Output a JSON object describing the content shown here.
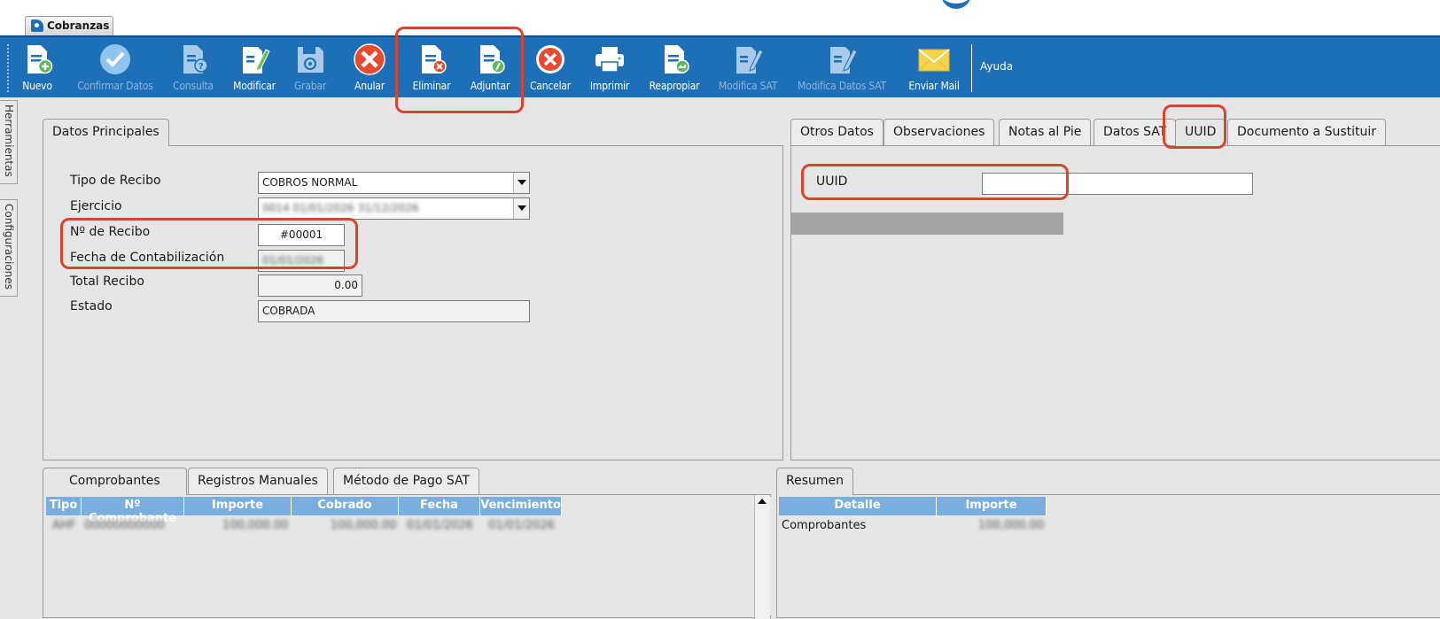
{
  "window": {
    "tab_label": "Cobranzas"
  },
  "toolbar": {
    "buttons": [
      {
        "label": "Nuevo",
        "icon": "new-document-icon",
        "enabled": true
      },
      {
        "label": "Confirmar Datos",
        "icon": "checkmark-icon",
        "enabled": false
      },
      {
        "label": "Consulta",
        "icon": "query-document-icon",
        "enabled": false
      },
      {
        "label": "Modificar",
        "icon": "edit-document-icon",
        "enabled": true
      },
      {
        "label": "Grabar",
        "icon": "save-disk-icon",
        "enabled": false
      },
      {
        "label": "Anular",
        "icon": "cancel-x-icon",
        "enabled": true
      },
      {
        "label": "Eliminar",
        "icon": "delete-document-icon",
        "enabled": true
      },
      {
        "label": "Adjuntar",
        "icon": "attach-document-icon",
        "enabled": true
      },
      {
        "label": "Cancelar",
        "icon": "cancel-circle-icon",
        "enabled": true
      },
      {
        "label": "Imprimir",
        "icon": "printer-icon",
        "enabled": true
      },
      {
        "label": "Reapropiar",
        "icon": "reassign-document-icon",
        "enabled": true
      },
      {
        "label": "Modifica SAT",
        "icon": "edit-sat-icon",
        "enabled": false
      },
      {
        "label": "Modifica Datos SAT",
        "icon": "edit-sat-data-icon",
        "enabled": false
      },
      {
        "label": "Enviar Mail",
        "icon": "mail-envelope-icon",
        "enabled": true
      }
    ],
    "help_label": "Ayuda"
  },
  "side_tabs": [
    "Herramientas",
    "Configuraciones"
  ],
  "main_panel": {
    "tab": "Datos Principales",
    "fields": {
      "tipo_recibo": {
        "label": "Tipo de Recibo",
        "value": "COBROS NORMAL"
      },
      "ejercicio": {
        "label": "Ejercicio",
        "value": "0014 01/01/2026 31/12/2026"
      },
      "nro_recibo": {
        "label": "Nº de Recibo",
        "value": "#00001"
      },
      "fecha_contab": {
        "label": "Fecha de Contabilización",
        "value": "01/01/2026"
      },
      "total_recibo": {
        "label": "Total Recibo",
        "value": "0.00"
      },
      "estado": {
        "label": "Estado",
        "value": "COBRADA"
      }
    }
  },
  "right_panel": {
    "tabs": [
      "Otros Datos",
      "Observaciones",
      "Notas al Pie",
      "Datos SAT",
      "UUID",
      "Documento a Sustituir"
    ],
    "active_tab": "UUID",
    "uuid_label": "UUID",
    "uuid_value": ""
  },
  "bottom_left": {
    "tabs": [
      "Comprobantes",
      "Registros Manuales",
      "Método de Pago SAT"
    ],
    "columns": [
      "Tipo",
      "Nº Comprobante",
      "Importe",
      "Cobrado",
      "Fecha",
      "Vencimiento"
    ],
    "rows": [
      [
        "AHF",
        "00000000000",
        "100,000.00",
        "100,000.00",
        "01/01/2026",
        "01/01/2026"
      ]
    ]
  },
  "bottom_right": {
    "tab": "Resumen",
    "columns": [
      "Detalle",
      "Importe"
    ],
    "rows": [
      [
        "Comprobantes",
        "100,000.00"
      ]
    ]
  },
  "colors": {
    "toolbar": "#1d6fb7",
    "highlight": "#d9442c",
    "grid_header": "#7aaede"
  }
}
